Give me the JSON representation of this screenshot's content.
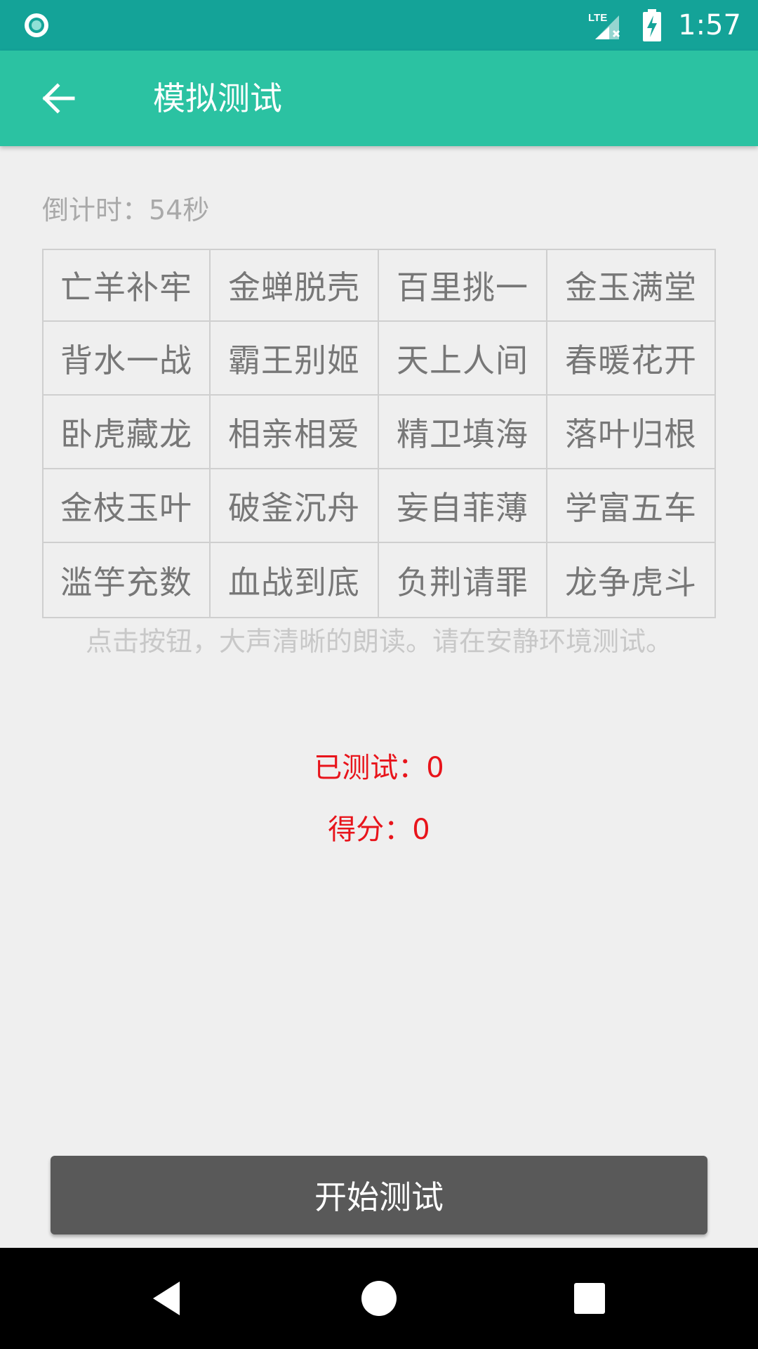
{
  "status_bar": {
    "time": "1:57",
    "network_label": "LTE",
    "icons": [
      "notification-circle-icon",
      "signal-icon",
      "battery-charging-icon"
    ]
  },
  "app_bar": {
    "title": "模拟测试",
    "back_icon": "arrow-back-icon"
  },
  "countdown": "倒计时：54秒",
  "idioms": [
    [
      "亡羊补牢",
      "金蝉脱壳",
      "百里挑一",
      "金玉满堂"
    ],
    [
      "背水一战",
      "霸王别姬",
      "天上人间",
      "春暖花开"
    ],
    [
      "卧虎藏龙",
      "相亲相爱",
      "精卫填海",
      "落叶归根"
    ],
    [
      "金枝玉叶",
      "破釜沉舟",
      "妄自菲薄",
      "学富五车"
    ],
    [
      "滥竽充数",
      "血战到底",
      "负荆请罪",
      "龙争虎斗"
    ]
  ],
  "hint": "点击按钮，大声清晰的朗读。请在安静环境测试。",
  "stats": {
    "tested": "已测试：0",
    "score": "得分：0"
  },
  "start_button": "开始测试",
  "colors": {
    "status_bar": "#14a398",
    "app_bar": "#2bc2a2",
    "stat_text": "#e8141b",
    "button": "#595959"
  }
}
